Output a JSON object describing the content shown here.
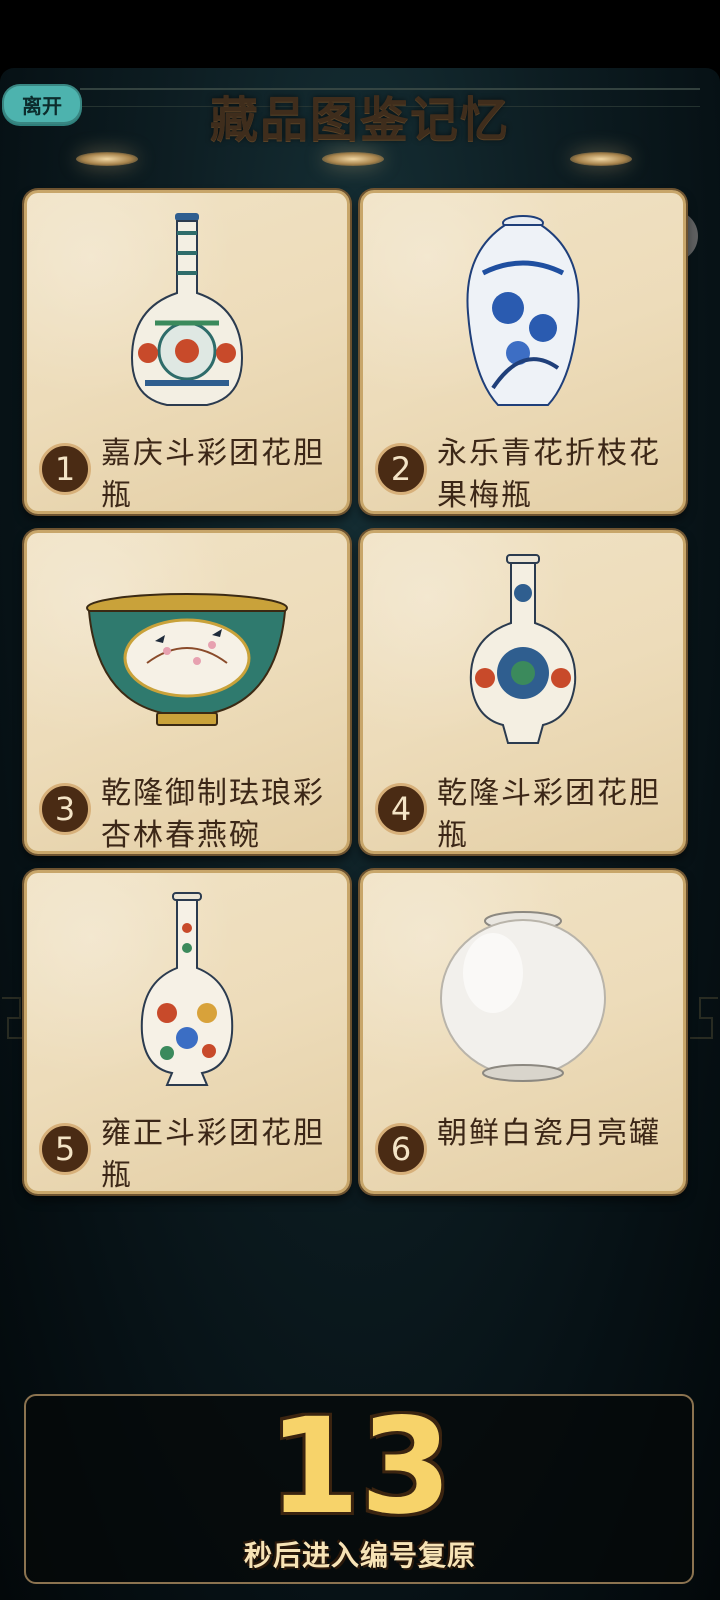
{
  "game": {
    "title": "藏品图鉴记忆",
    "leave_label": "离开",
    "countdown": {
      "seconds": "13",
      "caption": "秒后进入编号复原"
    }
  },
  "capsule": {
    "more_icon": "more-dots-icon",
    "close_icon": "target-close-icon"
  },
  "cards": [
    {
      "number": "1",
      "name": "嘉庆斗彩团花胆瓶",
      "art": "famille-rose-vase-icon"
    },
    {
      "number": "2",
      "name": "永乐青花折枝花果梅瓶",
      "art": "blue-white-meiping-icon"
    },
    {
      "number": "3",
      "name": "乾隆御制珐琅彩杏林春燕碗",
      "art": "enamel-bowl-icon"
    },
    {
      "number": "4",
      "name": "乾隆斗彩团花胆瓶",
      "art": "doucai-vase-icon"
    },
    {
      "number": "5",
      "name": "雍正斗彩团花胆瓶",
      "art": "doucai-bottle-vase-icon"
    },
    {
      "number": "6",
      "name": "朝鲜白瓷月亮罐",
      "art": "moon-jar-icon"
    }
  ],
  "colors": {
    "accent": "#4db3ae",
    "countdown": "#f7d36a",
    "card_border": "#c8a66a",
    "background": "#0d1d22"
  }
}
